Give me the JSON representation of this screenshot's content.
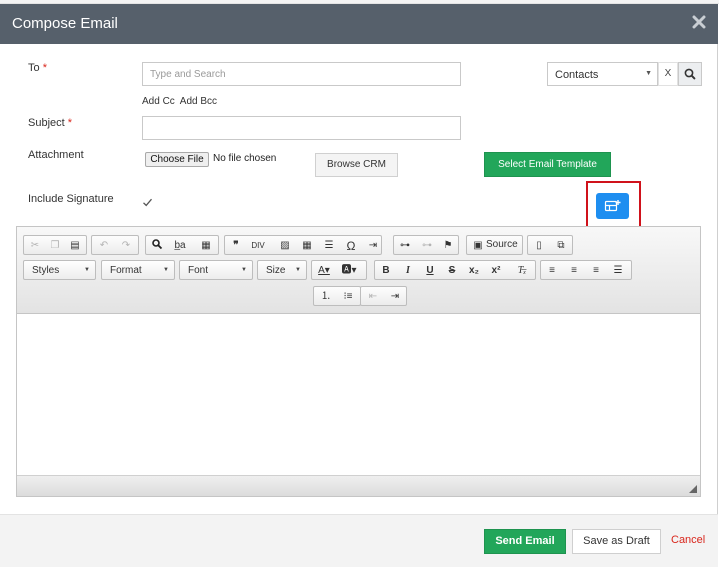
{
  "window": {
    "title": "Compose Email"
  },
  "form": {
    "to_label": "To",
    "required_mark": "*",
    "to_placeholder": "Type and Search",
    "contacts_value": "Contacts",
    "clear_label": "X",
    "add_cc": "Add Cc",
    "add_bcc": "Add Bcc",
    "subject_label": "Subject",
    "attachment_label": "Attachment",
    "choose_file": "Choose File",
    "no_file": "No file chosen",
    "browse_crm": "Browse CRM",
    "select_template": "Select Email Template",
    "signature_label": "Include Signature",
    "signature_checked": true
  },
  "editor": {
    "combos": {
      "styles": "Styles",
      "format": "Format",
      "font": "Font",
      "size": "Size"
    },
    "source_label": "Source",
    "content": ""
  },
  "footer": {
    "send": "Send Email",
    "draft": "Save as Draft",
    "cancel": "Cancel"
  },
  "colors": {
    "header_bg": "#56606b",
    "accent_green": "#22a65a",
    "accent_blue": "#1e8ef0",
    "highlight_red": "#d0121b",
    "cancel_red": "#d9261c"
  }
}
